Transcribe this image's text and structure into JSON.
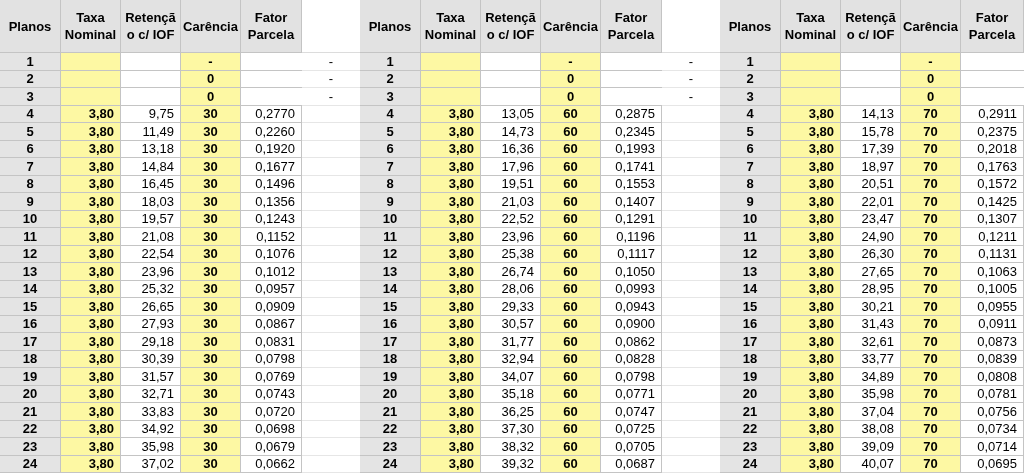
{
  "tables": [
    {
      "columns": [
        "Planos",
        "Taxa Nominal",
        "Retençã o c/ IOF",
        "Carência",
        "Fator Parcela"
      ],
      "rows": [
        {
          "plano": "1",
          "carencia": "-",
          "column_6": "-"
        },
        {
          "plano": "2",
          "carencia": "0",
          "column_6": "-"
        },
        {
          "plano": "3",
          "carencia": "0",
          "column_6": "-"
        },
        {
          "plano": "4",
          "taxa": "3,80",
          "retencao": "9,75",
          "carencia": "30",
          "fator": "0,2770"
        },
        {
          "plano": "5",
          "taxa": "3,80",
          "retencao": "11,49",
          "carencia": "30",
          "fator": "0,2260"
        },
        {
          "plano": "6",
          "taxa": "3,80",
          "retencao": "13,18",
          "carencia": "30",
          "fator": "0,1920"
        },
        {
          "plano": "7",
          "taxa": "3,80",
          "retencao": "14,84",
          "carencia": "30",
          "fator": "0,1677"
        },
        {
          "plano": "8",
          "taxa": "3,80",
          "retencao": "16,45",
          "carencia": "30",
          "fator": "0,1496"
        },
        {
          "plano": "9",
          "taxa": "3,80",
          "retencao": "18,03",
          "carencia": "30",
          "fator": "0,1356"
        },
        {
          "plano": "10",
          "taxa": "3,80",
          "retencao": "19,57",
          "carencia": "30",
          "fator": "0,1243"
        },
        {
          "plano": "11",
          "taxa": "3,80",
          "retencao": "21,08",
          "carencia": "30",
          "fator": "0,1152"
        },
        {
          "plano": "12",
          "taxa": "3,80",
          "retencao": "22,54",
          "carencia": "30",
          "fator": "0,1076"
        },
        {
          "plano": "13",
          "taxa": "3,80",
          "retencao": "23,96",
          "carencia": "30",
          "fator": "0,1012"
        },
        {
          "plano": "14",
          "taxa": "3,80",
          "retencao": "25,32",
          "carencia": "30",
          "fator": "0,0957"
        },
        {
          "plano": "15",
          "taxa": "3,80",
          "retencao": "26,65",
          "carencia": "30",
          "fator": "0,0909"
        },
        {
          "plano": "16",
          "taxa": "3,80",
          "retencao": "27,93",
          "carencia": "30",
          "fator": "0,0867"
        },
        {
          "plano": "17",
          "taxa": "3,80",
          "retencao": "29,18",
          "carencia": "30",
          "fator": "0,0831"
        },
        {
          "plano": "18",
          "taxa": "3,80",
          "retencao": "30,39",
          "carencia": "30",
          "fator": "0,0798"
        },
        {
          "plano": "19",
          "taxa": "3,80",
          "retencao": "31,57",
          "carencia": "30",
          "fator": "0,0769"
        },
        {
          "plano": "20",
          "taxa": "3,80",
          "retencao": "32,71",
          "carencia": "30",
          "fator": "0,0743"
        },
        {
          "plano": "21",
          "taxa": "3,80",
          "retencao": "33,83",
          "carencia": "30",
          "fator": "0,0720"
        },
        {
          "plano": "22",
          "taxa": "3,80",
          "retencao": "34,92",
          "carencia": "30",
          "fator": "0,0698"
        },
        {
          "plano": "23",
          "taxa": "3,80",
          "retencao": "35,98",
          "carencia": "30",
          "fator": "0,0679"
        },
        {
          "plano": "24",
          "taxa": "3,80",
          "retencao": "37,02",
          "carencia": "30",
          "fator": "0,0662"
        }
      ]
    },
    {
      "columns": [
        "Planos",
        "Taxa Nominal",
        "Retençã o c/ IOF",
        "Carência",
        "Fator Parcela"
      ],
      "rows": [
        {
          "plano": "1",
          "carencia": "-",
          "column_6": "-"
        },
        {
          "plano": "2",
          "carencia": "0",
          "column_6": "-"
        },
        {
          "plano": "3",
          "carencia": "0",
          "column_6": "-"
        },
        {
          "plano": "4",
          "taxa": "3,80",
          "retencao": "13,05",
          "carencia": "60",
          "fator": "0,2875"
        },
        {
          "plano": "5",
          "taxa": "3,80",
          "retencao": "14,73",
          "carencia": "60",
          "fator": "0,2345"
        },
        {
          "plano": "6",
          "taxa": "3,80",
          "retencao": "16,36",
          "carencia": "60",
          "fator": "0,1993"
        },
        {
          "plano": "7",
          "taxa": "3,80",
          "retencao": "17,96",
          "carencia": "60",
          "fator": "0,1741"
        },
        {
          "plano": "8",
          "taxa": "3,80",
          "retencao": "19,51",
          "carencia": "60",
          "fator": "0,1553"
        },
        {
          "plano": "9",
          "taxa": "3,80",
          "retencao": "21,03",
          "carencia": "60",
          "fator": "0,1407"
        },
        {
          "plano": "10",
          "taxa": "3,80",
          "retencao": "22,52",
          "carencia": "60",
          "fator": "0,1291"
        },
        {
          "plano": "11",
          "taxa": "3,80",
          "retencao": "23,96",
          "carencia": "60",
          "fator": "0,1196"
        },
        {
          "plano": "12",
          "taxa": "3,80",
          "retencao": "25,38",
          "carencia": "60",
          "fator": "0,1117"
        },
        {
          "plano": "13",
          "taxa": "3,80",
          "retencao": "26,74",
          "carencia": "60",
          "fator": "0,1050"
        },
        {
          "plano": "14",
          "taxa": "3,80",
          "retencao": "28,06",
          "carencia": "60",
          "fator": "0,0993"
        },
        {
          "plano": "15",
          "taxa": "3,80",
          "retencao": "29,33",
          "carencia": "60",
          "fator": "0,0943"
        },
        {
          "plano": "16",
          "taxa": "3,80",
          "retencao": "30,57",
          "carencia": "60",
          "fator": "0,0900"
        },
        {
          "plano": "17",
          "taxa": "3,80",
          "retencao": "31,77",
          "carencia": "60",
          "fator": "0,0862"
        },
        {
          "plano": "18",
          "taxa": "3,80",
          "retencao": "32,94",
          "carencia": "60",
          "fator": "0,0828"
        },
        {
          "plano": "19",
          "taxa": "3,80",
          "retencao": "34,07",
          "carencia": "60",
          "fator": "0,0798"
        },
        {
          "plano": "20",
          "taxa": "3,80",
          "retencao": "35,18",
          "carencia": "60",
          "fator": "0,0771"
        },
        {
          "plano": "21",
          "taxa": "3,80",
          "retencao": "36,25",
          "carencia": "60",
          "fator": "0,0747"
        },
        {
          "plano": "22",
          "taxa": "3,80",
          "retencao": "37,30",
          "carencia": "60",
          "fator": "0,0725"
        },
        {
          "plano": "23",
          "taxa": "3,80",
          "retencao": "38,32",
          "carencia": "60",
          "fator": "0,0705"
        },
        {
          "plano": "24",
          "taxa": "3,80",
          "retencao": "39,32",
          "carencia": "60",
          "fator": "0,0687"
        }
      ]
    },
    {
      "columns": [
        "Planos",
        "Taxa Nominal",
        "Retençã o c/ IOF",
        "Carência",
        "Fator Parcela"
      ],
      "rows": [
        {
          "plano": "1",
          "carencia": "-"
        },
        {
          "plano": "2",
          "carencia": "0"
        },
        {
          "plano": "3",
          "carencia": "0"
        },
        {
          "plano": "4",
          "taxa": "3,80",
          "retencao": "14,13",
          "carencia": "70",
          "fator": "0,2911"
        },
        {
          "plano": "5",
          "taxa": "3,80",
          "retencao": "15,78",
          "carencia": "70",
          "fator": "0,2375"
        },
        {
          "plano": "6",
          "taxa": "3,80",
          "retencao": "17,39",
          "carencia": "70",
          "fator": "0,2018"
        },
        {
          "plano": "7",
          "taxa": "3,80",
          "retencao": "18,97",
          "carencia": "70",
          "fator": "0,1763"
        },
        {
          "plano": "8",
          "taxa": "3,80",
          "retencao": "20,51",
          "carencia": "70",
          "fator": "0,1572"
        },
        {
          "plano": "9",
          "taxa": "3,80",
          "retencao": "22,01",
          "carencia": "70",
          "fator": "0,1425"
        },
        {
          "plano": "10",
          "taxa": "3,80",
          "retencao": "23,47",
          "carencia": "70",
          "fator": "0,1307"
        },
        {
          "plano": "11",
          "taxa": "3,80",
          "retencao": "24,90",
          "carencia": "70",
          "fator": "0,1211"
        },
        {
          "plano": "12",
          "taxa": "3,80",
          "retencao": "26,30",
          "carencia": "70",
          "fator": "0,1131"
        },
        {
          "plano": "13",
          "taxa": "3,80",
          "retencao": "27,65",
          "carencia": "70",
          "fator": "0,1063"
        },
        {
          "plano": "14",
          "taxa": "3,80",
          "retencao": "28,95",
          "carencia": "70",
          "fator": "0,1005"
        },
        {
          "plano": "15",
          "taxa": "3,80",
          "retencao": "30,21",
          "carencia": "70",
          "fator": "0,0955"
        },
        {
          "plano": "16",
          "taxa": "3,80",
          "retencao": "31,43",
          "carencia": "70",
          "fator": "0,0911"
        },
        {
          "plano": "17",
          "taxa": "3,80",
          "retencao": "32,61",
          "carencia": "70",
          "fator": "0,0873"
        },
        {
          "plano": "18",
          "taxa": "3,80",
          "retencao": "33,77",
          "carencia": "70",
          "fator": "0,0839"
        },
        {
          "plano": "19",
          "taxa": "3,80",
          "retencao": "34,89",
          "carencia": "70",
          "fator": "0,0808"
        },
        {
          "plano": "20",
          "taxa": "3,80",
          "retencao": "35,98",
          "carencia": "70",
          "fator": "0,0781"
        },
        {
          "plano": "21",
          "taxa": "3,80",
          "retencao": "37,04",
          "carencia": "70",
          "fator": "0,0756"
        },
        {
          "plano": "22",
          "taxa": "3,80",
          "retencao": "38,08",
          "carencia": "70",
          "fator": "0,0734"
        },
        {
          "plano": "23",
          "taxa": "3,80",
          "retencao": "39,09",
          "carencia": "70",
          "fator": "0,0714"
        },
        {
          "plano": "24",
          "taxa": "3,80",
          "retencao": "40,07",
          "carencia": "70",
          "fator": "0,0695"
        }
      ]
    }
  ]
}
